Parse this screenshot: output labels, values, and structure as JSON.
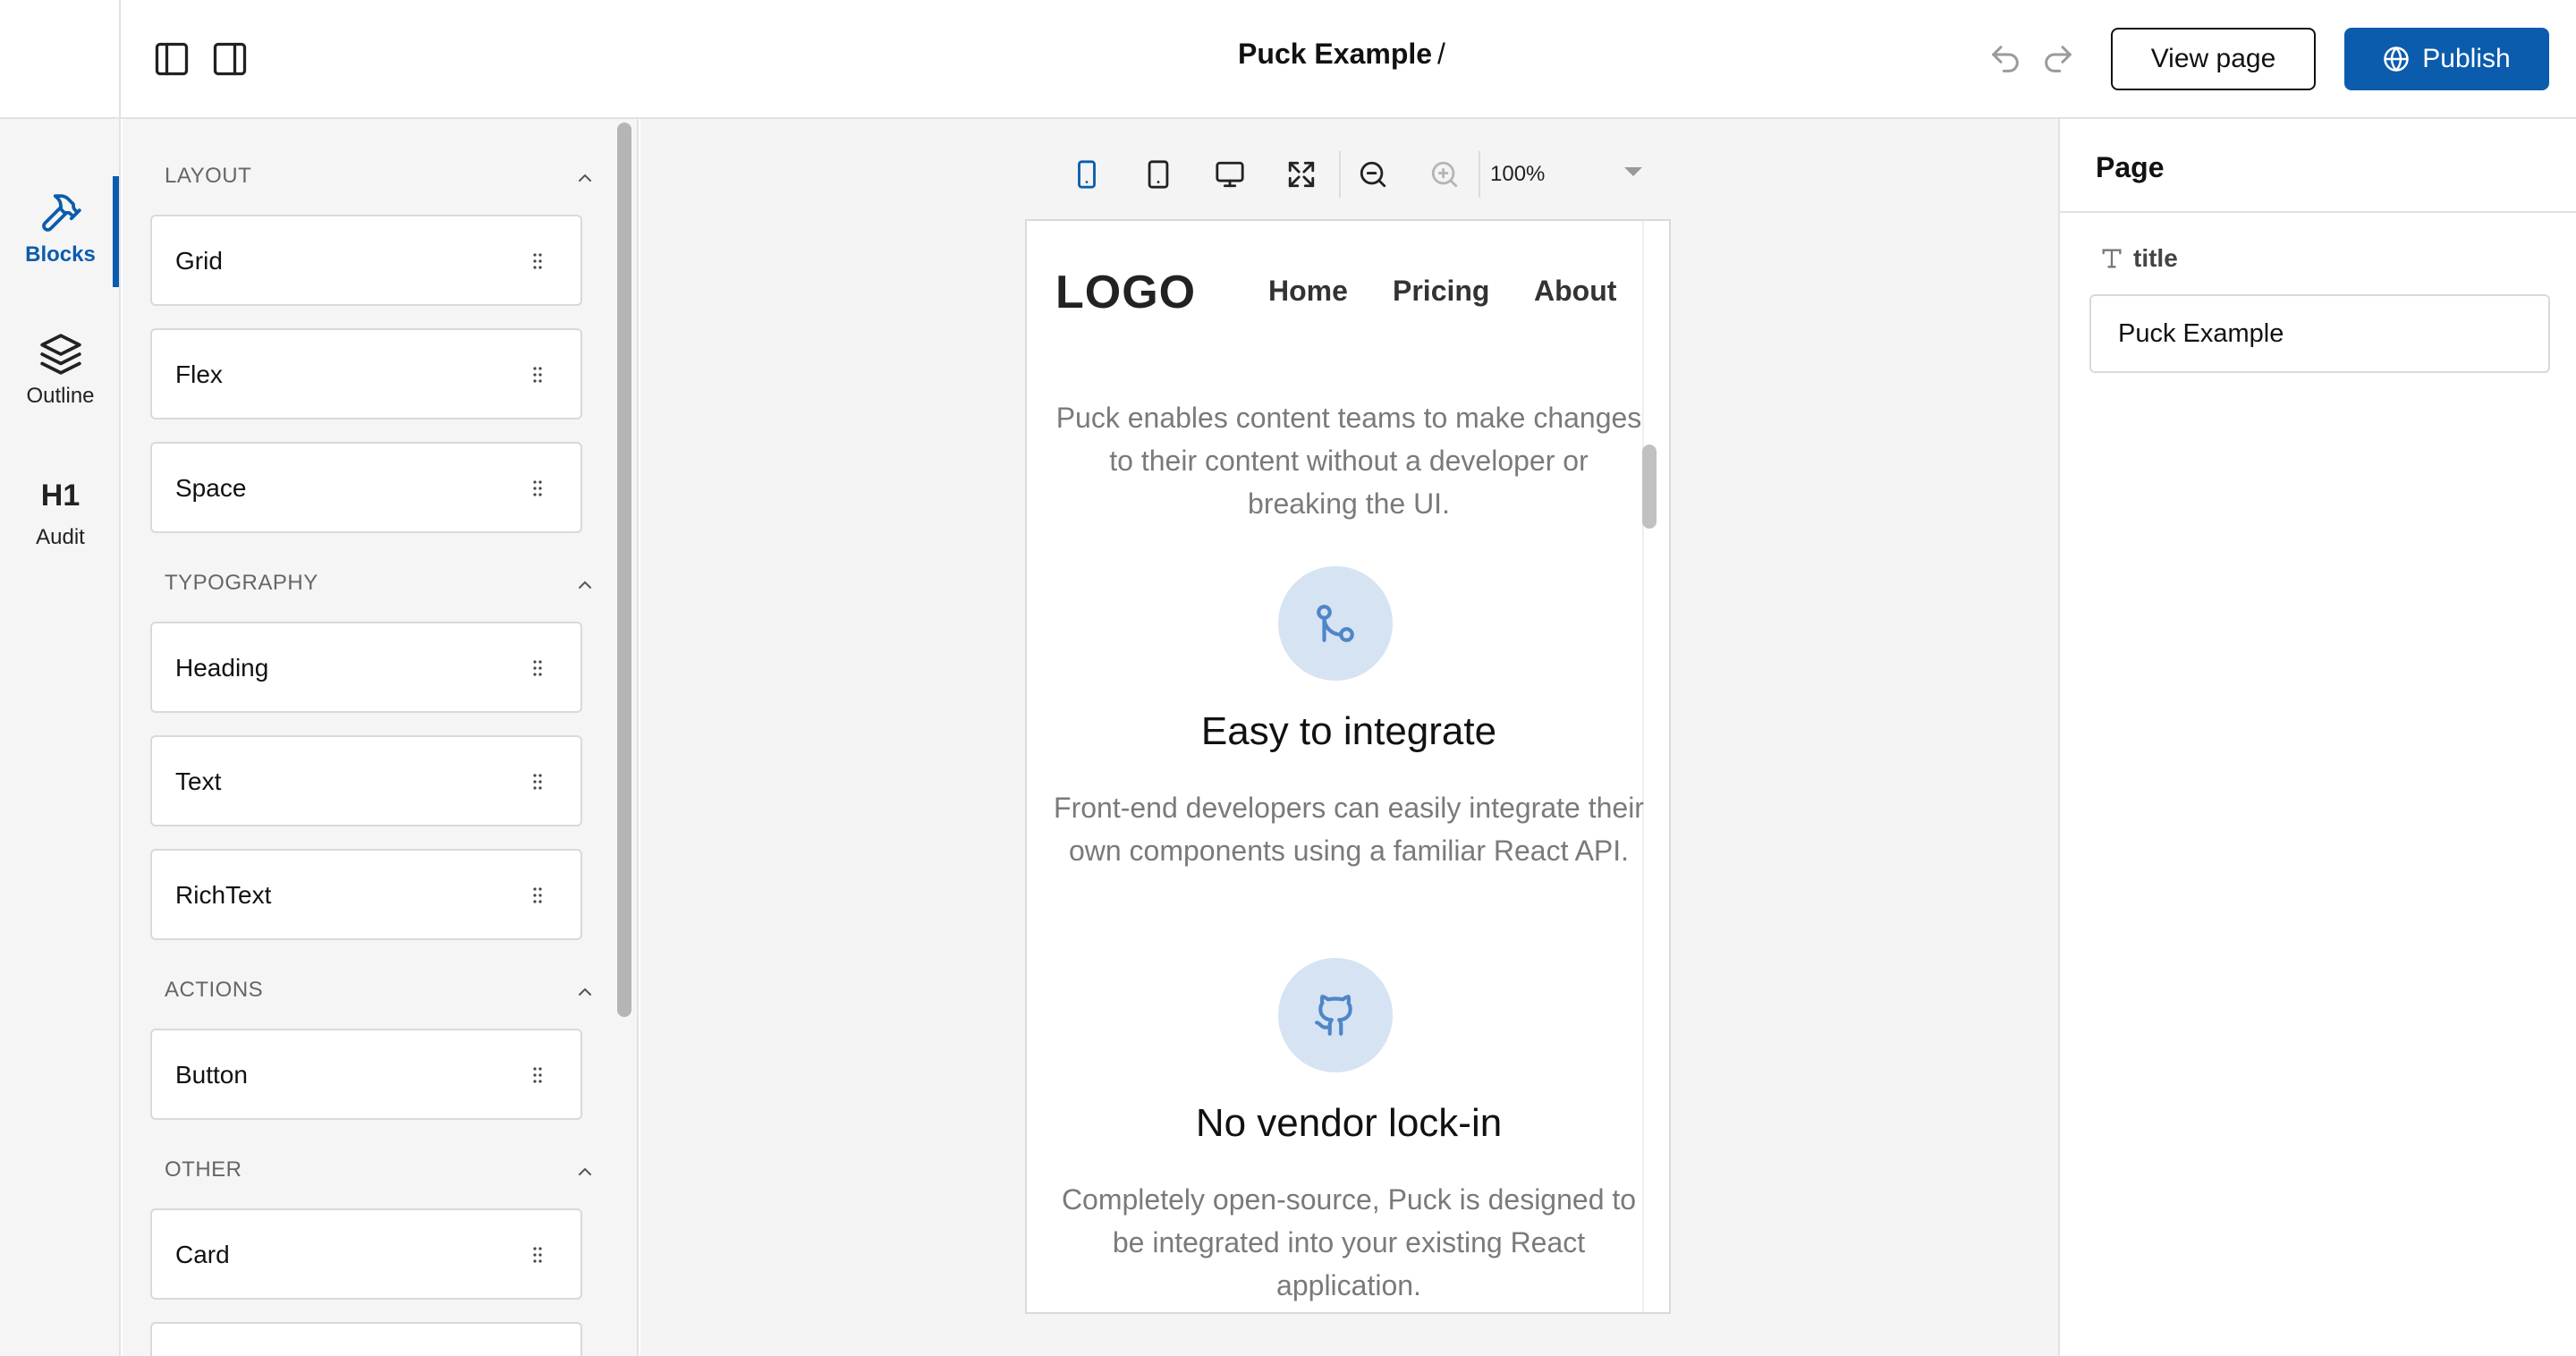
{
  "header": {
    "title": "Puck Example",
    "title_separator": "/",
    "view_page_label": "View page",
    "publish_label": "Publish",
    "icons": [
      "left-sidebar-toggle-icon",
      "right-sidebar-toggle-icon",
      "undo-icon",
      "redo-icon",
      "globe-icon"
    ]
  },
  "nav": {
    "items": [
      {
        "label": "Blocks",
        "icon": "hammer-icon",
        "active": true
      },
      {
        "label": "Outline",
        "icon": "layers-icon",
        "active": false
      },
      {
        "label": "Audit",
        "icon": "heading-icon",
        "active": false
      }
    ],
    "audit_glyph": "H1"
  },
  "components": {
    "sections": [
      {
        "title": "LAYOUT",
        "items": [
          "Grid",
          "Flex",
          "Space"
        ]
      },
      {
        "title": "TYPOGRAPHY",
        "items": [
          "Heading",
          "Text",
          "RichText"
        ]
      },
      {
        "title": "ACTIONS",
        "items": [
          "Button"
        ]
      },
      {
        "title": "OTHER",
        "items": [
          "Card"
        ]
      }
    ]
  },
  "toolbar": {
    "zoom": "100%",
    "viewports": [
      "mobile",
      "tablet",
      "desktop",
      "fullscreen"
    ],
    "active_viewport": "mobile"
  },
  "preview": {
    "logo": "LOGO",
    "nav": [
      "Home",
      "Pricing",
      "About"
    ],
    "intro": "Puck enables content teams to make changes to their content without a developer or breaking the UI.",
    "features": [
      {
        "icon": "git-merge-icon",
        "title": "Easy to integrate",
        "text": "Front-end developers can easily integrate their own components using a familiar React API."
      },
      {
        "icon": "github-icon",
        "title": "No vendor lock-in",
        "text": "Completely open-source, Puck is designed to be integrated into your existing React application."
      }
    ]
  },
  "fields": {
    "panel_title": "Page",
    "title_label": "title",
    "title_value": "Puck Example"
  },
  "colors": {
    "accent": "#0b5cad",
    "feature_circle": "#d6e3f3"
  }
}
